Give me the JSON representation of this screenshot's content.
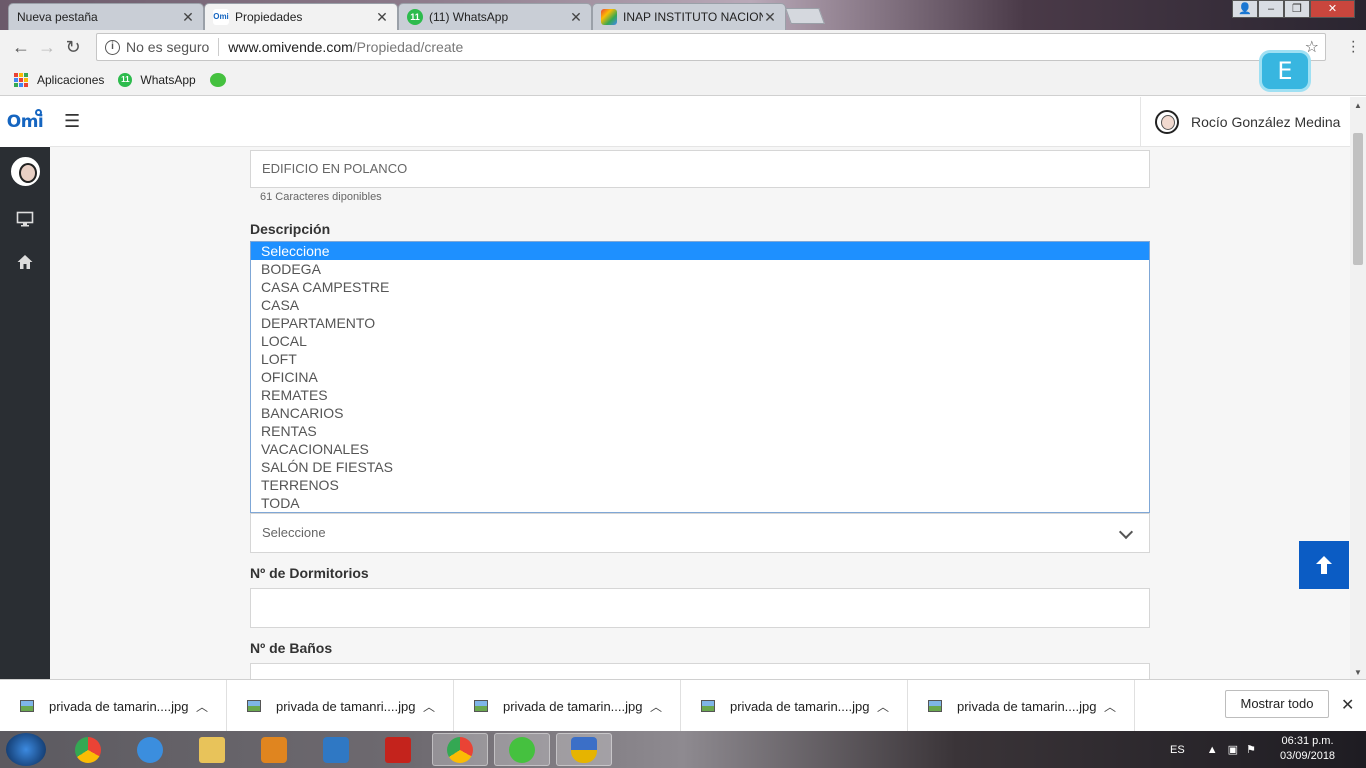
{
  "browser": {
    "tabs": [
      {
        "title": "Nueva pestaña",
        "active": false
      },
      {
        "title": "Propiedades",
        "active": true,
        "favicon": "Omi"
      },
      {
        "title": "(11) WhatsApp",
        "active": false,
        "favicon": "11"
      },
      {
        "title": "INAP INSTITUTO NACIONA",
        "active": false
      }
    ],
    "address": {
      "security": "No es seguro",
      "host": "www.omivende.com",
      "path": "/Propiedad/create"
    },
    "bookmarks": [
      {
        "label": "Aplicaciones",
        "icon": "apps-grid-icon"
      },
      {
        "label": "WhatsApp",
        "icon": "whatsapp-icon",
        "badge": "11"
      }
    ],
    "extension": {
      "label": "E"
    }
  },
  "app": {
    "logo": "Omi",
    "user_name": "Rocío González Medina"
  },
  "form": {
    "title_value": "EDIFICIO EN POLANCO",
    "title_helper": "61 Caracteres diponibles",
    "description_label": "Descripción",
    "description_options": [
      "Seleccione",
      "BODEGA",
      "CASA CAMPESTRE",
      "CASA",
      "DEPARTAMENTO",
      "LOCAL",
      "LOFT",
      "OFICINA",
      "REMATES",
      "BANCARIOS",
      "RENTAS",
      "VACACIONALES",
      "SALÓN DE FIESTAS",
      "TERRENOS",
      "TODA"
    ],
    "description_highlighted": "Seleccione",
    "select_value": "Seleccione",
    "dormitorios_label": "Nº de Dormitorios",
    "dormitorios_value": "",
    "banos_label": "Nº de Baños",
    "banos_value": ""
  },
  "downloads": {
    "items": [
      "privada de tamarin....jpg",
      "privada de tamanri....jpg",
      "privada de tamarin....jpg",
      "privada de tamarin....jpg",
      "privada de tamarin....jpg"
    ],
    "show_all_label": "Mostrar todo"
  },
  "taskbar": {
    "language": "ES",
    "time": "06:31 p.m.",
    "date": "03/09/2018"
  },
  "colors": {
    "accent_blue": "#1565c0",
    "option_highlight": "#1e90ff",
    "scroll_top_button": "#0b5cc4",
    "sidebar_bg": "#2a2e33"
  }
}
